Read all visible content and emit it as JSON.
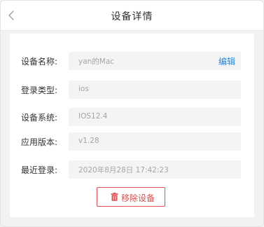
{
  "header": {
    "title": "设备详情",
    "back_icon": "chevron-left-icon"
  },
  "device": {
    "name": {
      "label": "设备名称:",
      "value": "yan的Mac",
      "edit_label": "编辑"
    },
    "login_type": {
      "label": "登录类型:",
      "value": "ios"
    },
    "system": {
      "label": "设备系统:",
      "value": "IOS12.4"
    },
    "app_version": {
      "label": "应用版本:",
      "value": "v1.28"
    },
    "last_login": {
      "label": "最近登录:",
      "value": "2020年8月28日 17:42:23"
    }
  },
  "actions": {
    "remove_label": "移除设备",
    "remove_icon": "trash-icon",
    "remove_color": "#e05050"
  },
  "colors": {
    "link": "#1e88e5",
    "field_bg": "#f4f4f4",
    "page_bg": "#f2f2f2"
  }
}
